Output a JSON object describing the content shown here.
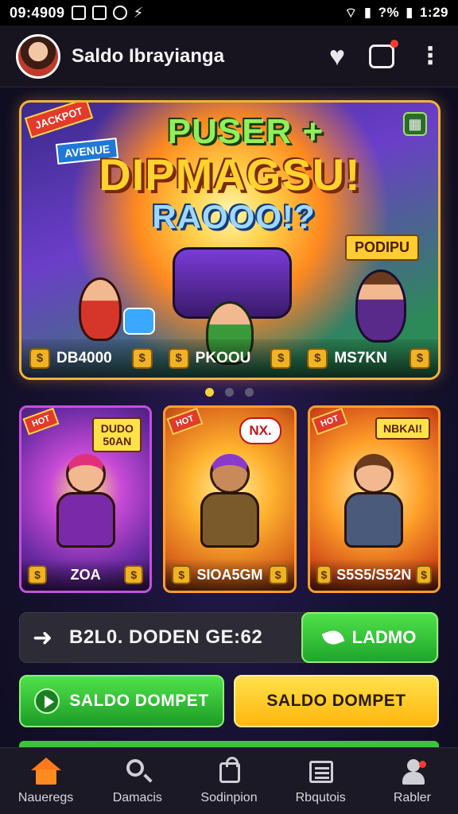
{
  "status_bar": {
    "time_left": "09:4909",
    "battery": "?%",
    "time_right": "1:29"
  },
  "app_bar": {
    "title": "Saldo Ibrayianga"
  },
  "hero": {
    "corner_tag": "JACKPOT",
    "sub_tag": "AVENUE",
    "title_line1": "PUSER +",
    "title_line2": "DIPMAGSU!",
    "title_line3": "RAOOO!?",
    "side_label": "PODIPU",
    "stats": [
      {
        "value": "DB4000",
        "icon": "coin-icon"
      },
      {
        "value": "PKOOU",
        "icon": "coin-icon"
      },
      {
        "value": "MS7KN",
        "icon": "coin-icon"
      }
    ]
  },
  "carousel": {
    "active_index": 0,
    "count": 3
  },
  "cards": [
    {
      "tag": "HOT",
      "badge": "DUDO 50AN",
      "value": "ZOA"
    },
    {
      "tag": "HOT",
      "bubble": "NX.",
      "value": "SIOA5GM"
    },
    {
      "tag": "HOT",
      "badge": "NBKAI!",
      "value": "S5S5/S52N"
    }
  ],
  "promo": {
    "text": "B2L0. DODEN GE:62",
    "button_label": "LADMO"
  },
  "saldo_buttons": [
    {
      "label": "SALDO DOMPET",
      "style": "green"
    },
    {
      "label": "SALDO DOMPET",
      "style": "yellow"
    }
  ],
  "bottom_nav": [
    {
      "label": "Naueregs",
      "icon": "home-icon",
      "active": true
    },
    {
      "label": "Damacis",
      "icon": "search-icon",
      "active": false
    },
    {
      "label": "Sodinpion",
      "icon": "bag-icon",
      "active": false
    },
    {
      "label": "Rbqutois",
      "icon": "list-icon",
      "active": false
    },
    {
      "label": "Rabler",
      "icon": "profile-icon",
      "active": false
    }
  ],
  "colors": {
    "accent_green": "#3ac43a",
    "accent_yellow": "#ffc21a",
    "active_nav": "#ff7a1a",
    "dot_active": "#f3d23a"
  }
}
